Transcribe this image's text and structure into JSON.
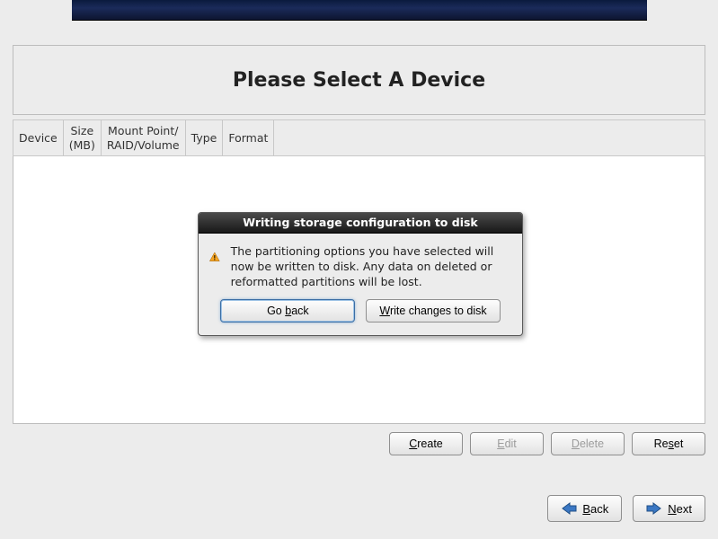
{
  "title": "Please Select A Device",
  "table": {
    "columns": [
      "Device",
      "Size\n(MB)",
      "Mount Point/\nRAID/Volume",
      "Type",
      "Format",
      ""
    ]
  },
  "actions": {
    "create": "Create",
    "edit": "Edit",
    "delete": "Delete",
    "reset": "Reset"
  },
  "nav": {
    "back": "Back",
    "next": "Next"
  },
  "dialog": {
    "title": "Writing storage configuration to disk",
    "message": "The partitioning options you have selected will now be written to disk.  Any data on deleted or reformatted partitions will be lost.",
    "go_back": "Go back",
    "write": "Write changes to disk"
  }
}
